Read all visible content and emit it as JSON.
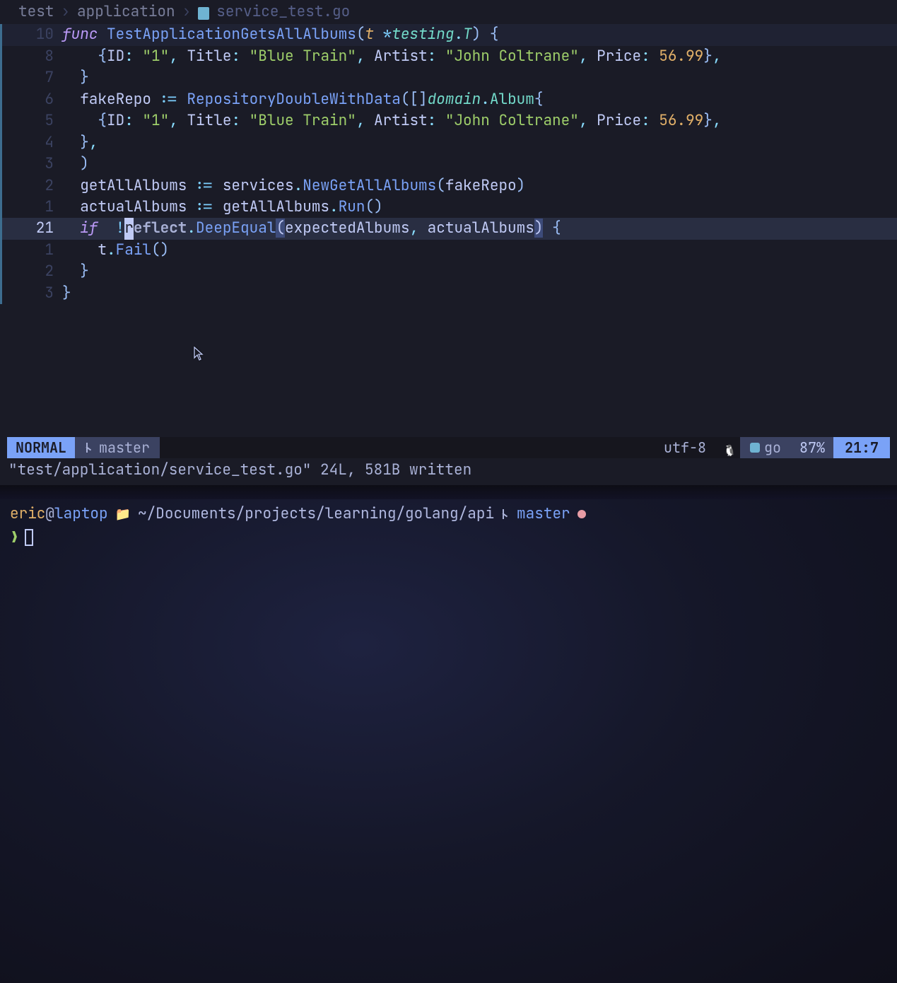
{
  "breadcrumb": {
    "segments": [
      "test",
      "application"
    ],
    "file": "service_test.go",
    "separator": "›"
  },
  "gutter_numbers": [
    "10",
    "8",
    "7",
    "6",
    "5",
    "4",
    "3",
    "2",
    "1",
    "21",
    "1",
    "2",
    "3"
  ],
  "current_line_index": 9,
  "code_tokens": [
    [
      [
        "kw",
        "func "
      ],
      [
        "fn",
        "TestApplicationGetsAllAlbums"
      ],
      [
        "paren",
        "("
      ],
      [
        "param",
        "t "
      ],
      [
        "op",
        "*"
      ],
      [
        "type",
        "testing"
      ],
      [
        "punc",
        "."
      ],
      [
        "type",
        "T"
      ],
      [
        "paren",
        ")"
      ],
      [
        "ident",
        " "
      ],
      [
        "brace",
        "{"
      ]
    ],
    [
      [
        "ident",
        "    "
      ],
      [
        "brace",
        "{"
      ],
      [
        "field",
        "ID"
      ],
      [
        "punc",
        ": "
      ],
      [
        "str",
        "\"1\""
      ],
      [
        "punc",
        ", "
      ],
      [
        "field",
        "Title"
      ],
      [
        "punc",
        ": "
      ],
      [
        "str",
        "\"Blue Train\""
      ],
      [
        "punc",
        ", "
      ],
      [
        "field",
        "Artist"
      ],
      [
        "punc",
        ": "
      ],
      [
        "str",
        "\"John Coltrane\""
      ],
      [
        "punc",
        ", "
      ],
      [
        "field",
        "Price"
      ],
      [
        "punc",
        ": "
      ],
      [
        "num",
        "56.99"
      ],
      [
        "brace",
        "}"
      ],
      [
        "punc",
        ","
      ]
    ],
    [
      [
        "ident",
        "  "
      ],
      [
        "brace",
        "}"
      ]
    ],
    [
      [
        "ident",
        "  "
      ],
      [
        "ident",
        "fakeRepo "
      ],
      [
        "op",
        ":= "
      ],
      [
        "fncall",
        "RepositoryDoubleWithData"
      ],
      [
        "paren",
        "("
      ],
      [
        "paren",
        "["
      ],
      [
        "paren",
        "]"
      ],
      [
        "type",
        "domain"
      ],
      [
        "punc",
        "."
      ],
      [
        "pkg2",
        "Album"
      ],
      [
        "brace",
        "{"
      ]
    ],
    [
      [
        "ident",
        "    "
      ],
      [
        "brace",
        "{"
      ],
      [
        "field",
        "ID"
      ],
      [
        "punc",
        ": "
      ],
      [
        "str",
        "\"1\""
      ],
      [
        "punc",
        ", "
      ],
      [
        "field",
        "Title"
      ],
      [
        "punc",
        ": "
      ],
      [
        "str",
        "\"Blue Train\""
      ],
      [
        "punc",
        ", "
      ],
      [
        "field",
        "Artist"
      ],
      [
        "punc",
        ": "
      ],
      [
        "str",
        "\"John Coltrane\""
      ],
      [
        "punc",
        ", "
      ],
      [
        "field",
        "Price"
      ],
      [
        "punc",
        ": "
      ],
      [
        "num",
        "56.99"
      ],
      [
        "brace",
        "}"
      ],
      [
        "punc",
        ","
      ]
    ],
    [
      [
        "ident",
        "  "
      ],
      [
        "brace",
        "}"
      ],
      [
        "punc",
        ","
      ]
    ],
    [
      [
        "ident",
        "  "
      ],
      [
        "paren",
        ")"
      ]
    ],
    [
      [
        "ident",
        "  "
      ],
      [
        "ident",
        "getAllAlbums "
      ],
      [
        "op",
        ":= "
      ],
      [
        "ident",
        "services"
      ],
      [
        "punc",
        "."
      ],
      [
        "fncall",
        "NewGetAllAlbums"
      ],
      [
        "paren",
        "("
      ],
      [
        "ident",
        "fakeRepo"
      ],
      [
        "paren",
        ")"
      ]
    ],
    [
      [
        "ident",
        "  "
      ],
      [
        "ident",
        "actualAlbums "
      ],
      [
        "op",
        ":= "
      ],
      [
        "ident",
        "getAllAlbums"
      ],
      [
        "punc",
        "."
      ],
      [
        "fncall",
        "Run"
      ],
      [
        "paren",
        "("
      ],
      [
        "paren",
        ")"
      ]
    ],
    [
      [
        "ident",
        "  "
      ],
      [
        "kw",
        "if "
      ],
      [
        "op",
        " !"
      ],
      [
        "cursor",
        "r"
      ],
      [
        "bold",
        "eflect"
      ],
      [
        "punc",
        "."
      ],
      [
        "fncall",
        "DeepEqual"
      ],
      [
        "paren-match",
        "("
      ],
      [
        "ident",
        "expectedAlbums"
      ],
      [
        "punc",
        ", "
      ],
      [
        "ident",
        "actualAlbums"
      ],
      [
        "paren-match",
        ")"
      ],
      [
        "ident",
        " "
      ],
      [
        "brace",
        "{"
      ]
    ],
    [
      [
        "ident",
        "    "
      ],
      [
        "ident",
        "t"
      ],
      [
        "punc",
        "."
      ],
      [
        "fncall",
        "Fail"
      ],
      [
        "paren",
        "("
      ],
      [
        "paren",
        ")"
      ]
    ],
    [
      [
        "ident",
        "  "
      ],
      [
        "brace",
        "}"
      ]
    ],
    [
      [
        "brace",
        "}"
      ]
    ]
  ],
  "statusline": {
    "mode": "NORMAL",
    "branch": "master",
    "encoding": "utf-8",
    "filetype": "go",
    "percent": "87%",
    "position": "21:7"
  },
  "message": "\"test/application/service_test.go\" 24L, 581B written",
  "terminal": {
    "user": "eric",
    "host": "laptop",
    "path": "~/Documents/projects/learning/golang/api",
    "branch": "master",
    "prompt": "❯"
  }
}
